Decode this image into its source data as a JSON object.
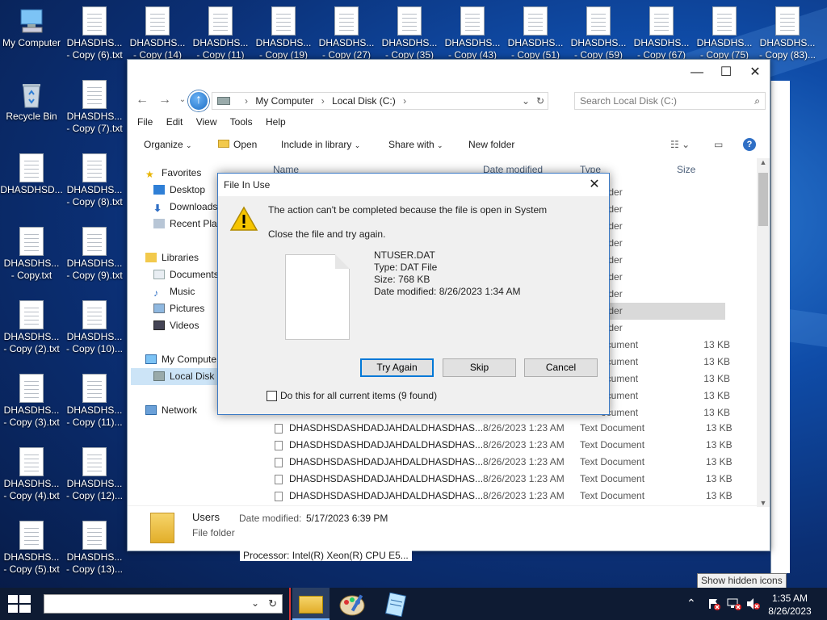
{
  "desktop": {
    "icons": [
      {
        "label1": "My Computer",
        "label2": ""
      },
      {
        "label1": "Recycle Bin",
        "label2": ""
      },
      {
        "label1": "DHASDHSD...",
        "label2": ""
      },
      {
        "label1": "DHASDHS...",
        "label2": "- Copy.txt"
      },
      {
        "label1": "DHASDHS...",
        "label2": "- Copy (2).txt"
      },
      {
        "label1": "DHASDHS...",
        "label2": "- Copy (3).txt"
      },
      {
        "label1": "DHASDHS...",
        "label2": "- Copy (4).txt"
      },
      {
        "label1": "DHASDHS...",
        "label2": "- Copy (5).txt"
      },
      {
        "label1": "DHASDHS...",
        "label2": "- Copy (6).txt"
      },
      {
        "label1": "DHASDHS...",
        "label2": "- Copy (7).txt"
      },
      {
        "label1": "DHASDHS...",
        "label2": "- Copy (8).txt"
      },
      {
        "label1": "DHASDHS...",
        "label2": "- Copy (9).txt"
      },
      {
        "label1": "DHASDHS...",
        "label2": "- Copy (10)..."
      },
      {
        "label1": "DHASDHS...",
        "label2": "- Copy (11)..."
      },
      {
        "label1": "DHASDHS...",
        "label2": "- Copy (12)..."
      },
      {
        "label1": "DHASDHS...",
        "label2": "- Copy (13)..."
      },
      {
        "label1": "DHASDHS...",
        "label2": "- Copy (14)"
      },
      {
        "label1": "DHASDHS...",
        "label2": "- Copy (11)"
      },
      {
        "label1": "DHASDHS...",
        "label2": "- Copy (19)"
      },
      {
        "label1": "DHASDHS...",
        "label2": "- Copy (27)"
      },
      {
        "label1": "DHASDHS...",
        "label2": "- Copy (35)"
      },
      {
        "label1": "DHASDHS...",
        "label2": "- Copy (43)"
      },
      {
        "label1": "DHASDHS...",
        "label2": "- Copy (51)"
      },
      {
        "label1": "DHASDHS...",
        "label2": "- Copy (59)"
      },
      {
        "label1": "DHASDHS...",
        "label2": "- Copy (67)"
      },
      {
        "label1": "DHASDHS...",
        "label2": "- Copy (75)"
      },
      {
        "label1": "DHASDHS...",
        "label2": "- Copy (83)..."
      }
    ]
  },
  "explorer": {
    "address": {
      "crumb1": "My Computer",
      "crumb2": "Local Disk (C:)"
    },
    "search_placeholder": "Search Local Disk (C:)",
    "menu": [
      "File",
      "Edit",
      "View",
      "Tools",
      "Help"
    ],
    "toolbar": {
      "organize": "Organize",
      "open": "Open",
      "include": "Include in library",
      "share": "Share with",
      "newfolder": "New folder"
    },
    "nav": {
      "favorites": "Favorites",
      "desktop": "Desktop",
      "downloads": "Downloads",
      "recent": "Recent Plac",
      "libraries": "Libraries",
      "documents": "Documents",
      "music": "Music",
      "pictures": "Pictures",
      "videos": "Videos",
      "computer": "My Compute",
      "localdisk": "Local Disk (",
      "network": "Network"
    },
    "columns": {
      "name": "Name",
      "date": "Date modified",
      "type": "Type",
      "size": "Size"
    },
    "folder_type": "older",
    "file_rows": [
      {
        "name": "DHASDHSDASHDADJAHDALDHASDHAS...",
        "date": "8/26/2023 1:23 AM",
        "type": "Text Document",
        "size": "13 KB"
      },
      {
        "name": "DHASDHSDASHDADJAHDALDHASDHAS...",
        "date": "8/26/2023 1:23 AM",
        "type": "Text Document",
        "size": "13 KB"
      },
      {
        "name": "DHASDHSDASHDADJAHDALDHASDHAS...",
        "date": "8/26/2023 1:23 AM",
        "type": "Text Document",
        "size": "13 KB"
      },
      {
        "name": "DHASDHSDASHDADJAHDALDHASDHAS...",
        "date": "8/26/2023 1:23 AM",
        "type": "Text Document",
        "size": "13 KB"
      },
      {
        "name": "DHASDHSDASHDADJAHDALDHASDHAS...",
        "date": "8/26/2023 1:23 AM",
        "type": "Text Document",
        "size": "13 KB"
      }
    ],
    "partial_type": "ocument",
    "partial_size": "13 KB",
    "details": {
      "name": "Users",
      "date_label": "Date modified:",
      "date_value": "5/17/2023 6:39 PM",
      "kind": "File folder"
    },
    "processor_label": "Processor:",
    "processor_value": "Intel(R) Xeon(R) CPU E5..."
  },
  "dialog": {
    "title": "File In Use",
    "message": "The action can't be completed because the file is open in System",
    "hint": "Close the file and try again.",
    "file": {
      "name": "NTUSER.DAT",
      "type": "Type: DAT File",
      "size": "Size: 768 KB",
      "date": "Date modified: 8/26/2023 1:34 AM"
    },
    "buttons": {
      "try_again": "Try Again",
      "skip": "Skip",
      "cancel": "Cancel"
    },
    "checkbox_label": "Do this for all current items (9 found)"
  },
  "taskbar": {
    "tooltip": "Show hidden icons",
    "time": "1:35 AM",
    "date": "8/26/2023"
  },
  "colors": {
    "accent": "#0078d7",
    "taskbar": "#0e1b33"
  }
}
